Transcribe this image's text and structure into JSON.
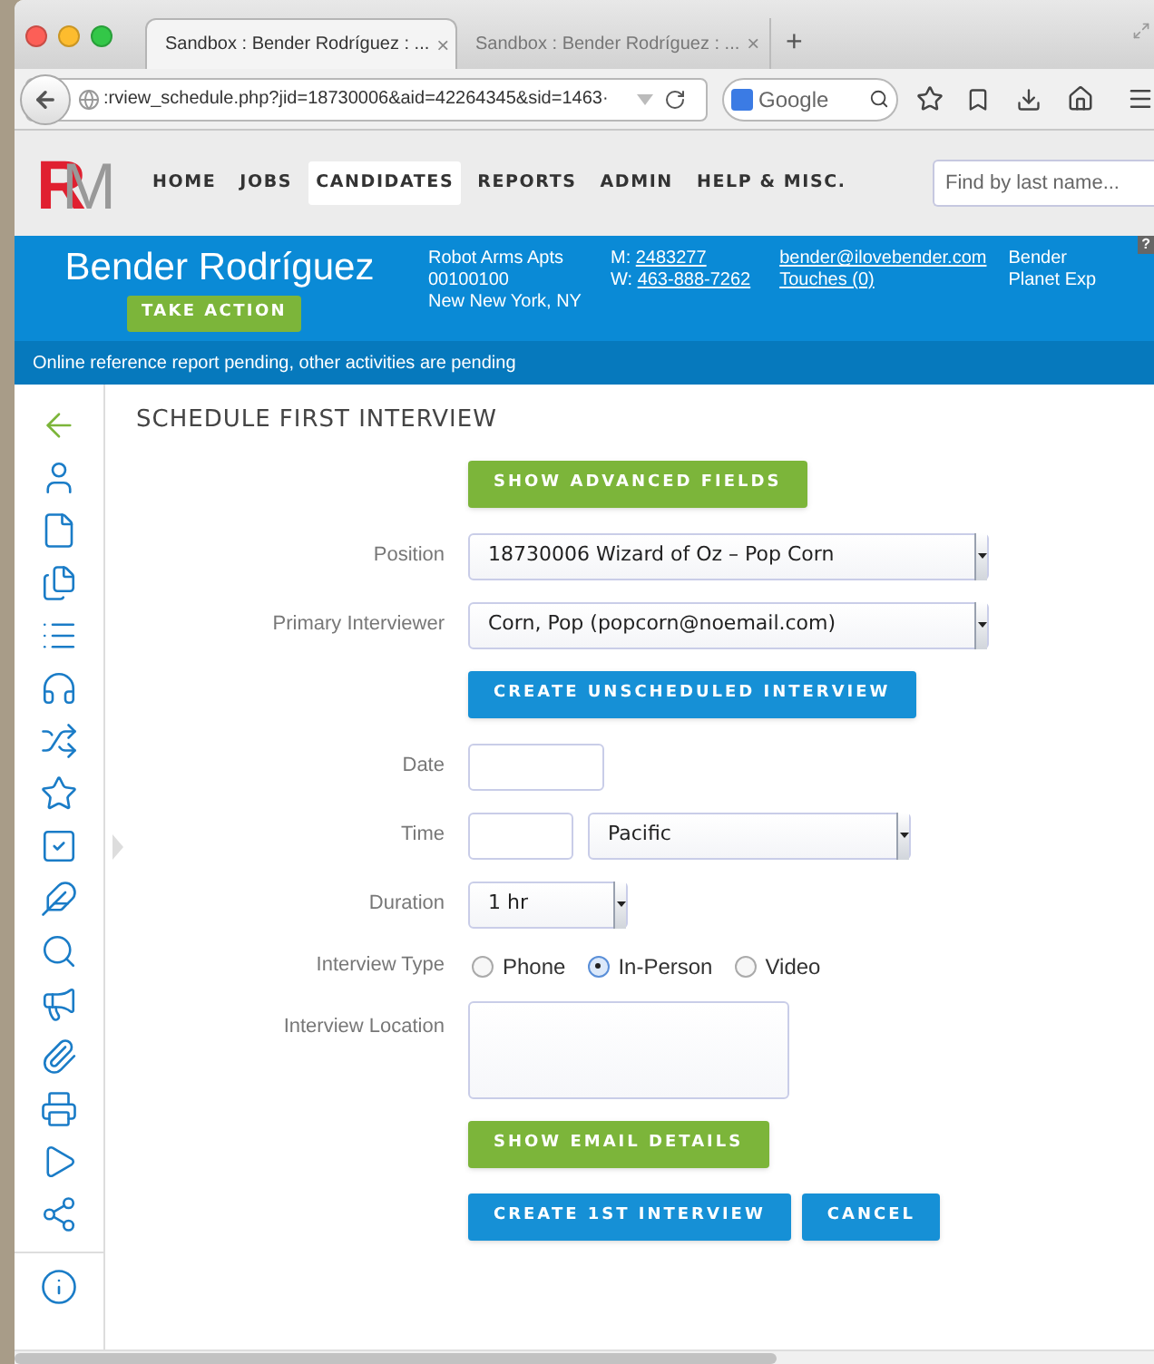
{
  "browser": {
    "tabs": [
      {
        "title": "Sandbox : Bender Rodríguez : ...",
        "close": "×",
        "selected": true
      },
      {
        "title": "Sandbox : Bender Rodríguez : ...",
        "close": "×",
        "selected": false
      }
    ],
    "new_tab": "+",
    "address": ":rview_schedule.php?jid=18730006&aid=42264345&sid=1463·",
    "search_engine": "Google"
  },
  "app": {
    "logo": [
      "R",
      "M"
    ],
    "nav": [
      {
        "label": "HOME",
        "selected": false
      },
      {
        "label": "JOBS",
        "selected": false
      },
      {
        "label": "CANDIDATES",
        "selected": true
      },
      {
        "label": "REPORTS",
        "selected": false
      },
      {
        "label": "ADMIN",
        "selected": false
      },
      {
        "label": "HELP & MISC.",
        "selected": false
      }
    ],
    "search": {
      "placeholder": "Find by last name..."
    }
  },
  "candidate": {
    "name": "Bender Rodríguez",
    "action_button": "TAKE ACTION",
    "address": [
      "Robot Arms Apts",
      "00100100",
      "New New York, NY"
    ],
    "phones": [
      {
        "prefix": "M:",
        "number": "2483277"
      },
      {
        "prefix": "W:",
        "number": "463-888-7262"
      }
    ],
    "email": "bender@ilovebender.com",
    "touches": "Touches (0)",
    "extra": [
      "Bender",
      "Planet Exp"
    ],
    "help": "?"
  },
  "alert": "Online reference report pending, other activities are pending",
  "page_title": "SCHEDULE FIRST INTERVIEW",
  "form": [
    {
      "kind": "button",
      "color": "#7cb53a",
      "label": "SHOW ADVANCED FIELDS"
    },
    {
      "kind": "select",
      "label": "Position",
      "value": "18730006 Wizard of Oz – Pop Corn"
    },
    {
      "kind": "select",
      "label": "Primary Interviewer",
      "value": "Corn, Pop (popcorn@noemail.com)"
    },
    {
      "kind": "button",
      "color": "#1690d6",
      "label": "CREATE UNSCHEDULED INTERVIEW"
    },
    {
      "kind": "text",
      "label": "Date"
    },
    {
      "kind": "time",
      "label": "Time",
      "zone": "Pacific"
    },
    {
      "kind": "duration",
      "label": "Duration",
      "value": "1 hr"
    },
    {
      "kind": "radio",
      "label": "Interview Type",
      "options": [
        {
          "label": "Phone",
          "selected": false
        },
        {
          "label": "In-Person",
          "selected": true
        },
        {
          "label": "Video",
          "selected": false
        }
      ]
    },
    {
      "kind": "textarea",
      "label": "Interview Location"
    },
    {
      "kind": "button",
      "color": "#7cb53a",
      "label": "SHOW EMAIL DETAILS"
    },
    {
      "kind": "actions",
      "buttons": [
        "CREATE 1ST INTERVIEW",
        "CANCEL"
      ]
    }
  ]
}
